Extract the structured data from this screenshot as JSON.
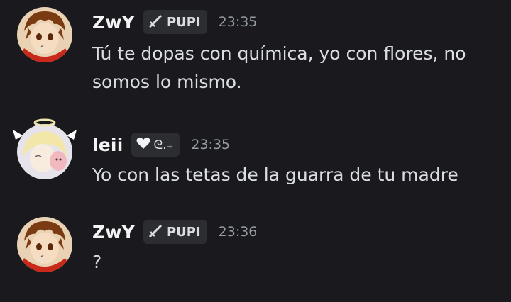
{
  "messages": [
    {
      "username": "ZwY",
      "tag": "PUPI",
      "tag_icon": "sword-icon",
      "time": "23:35",
      "text": "Tú te dopas con química, yo con flores, no somos lo mismo."
    },
    {
      "username": "leii",
      "tag": "ᘓ.₊",
      "tag_icon": "heart-icon",
      "time": "23:35",
      "text": "Yo con las tetas de la guarra de tu madre"
    },
    {
      "username": "ZwY",
      "tag": "PUPI",
      "tag_icon": "sword-icon",
      "time": "23:36",
      "text": "?"
    }
  ],
  "colors": {
    "background": "#1a1a1e",
    "username": "#f2f3f5",
    "text": "#dbdee1",
    "timestamp": "#949ba4",
    "tag_bg": "#2b2d31"
  }
}
